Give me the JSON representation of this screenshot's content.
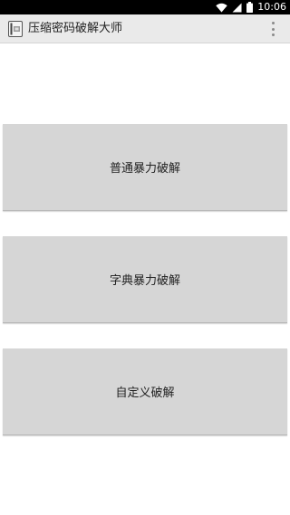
{
  "status_bar": {
    "time": "10:06",
    "icons": [
      "wifi-icon",
      "cell-signal-icon",
      "battery-icon"
    ]
  },
  "app_bar": {
    "title": "压缩密码破解大师",
    "menu_icon": "overflow-menu-icon"
  },
  "buttons": [
    {
      "label": "普通暴力破解"
    },
    {
      "label": "字典暴力破解"
    },
    {
      "label": "自定义破解"
    }
  ],
  "colors": {
    "status_bar_bg": "#000000",
    "app_bar_bg": "#eaeaea",
    "button_bg": "#d6d6d6",
    "page_bg": "#ffffff"
  }
}
